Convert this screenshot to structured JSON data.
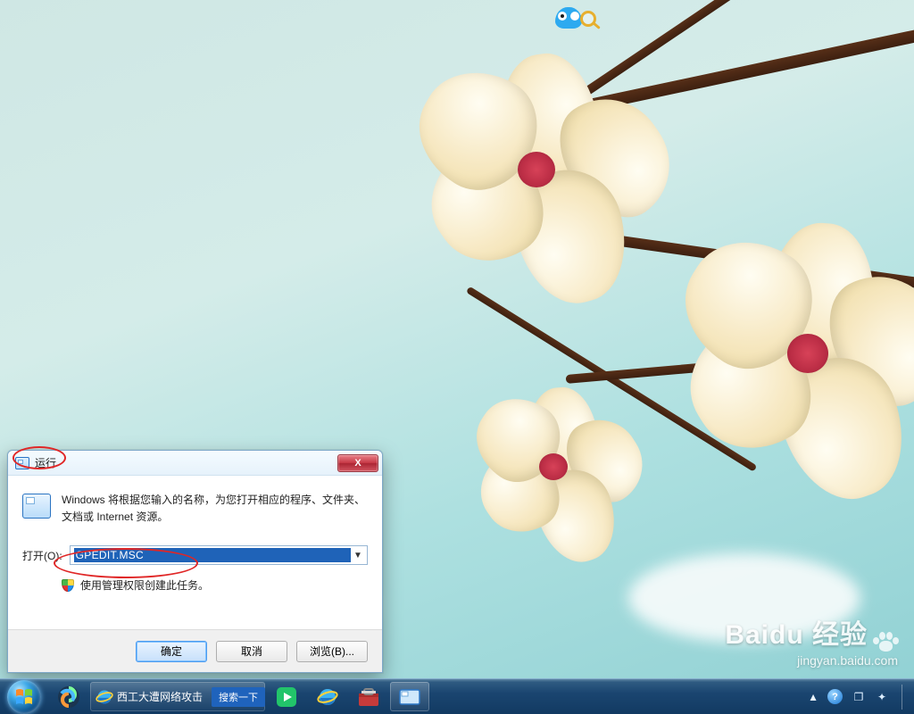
{
  "desktop": {
    "icon_name": "owl-search-app"
  },
  "run_dialog": {
    "title": "运行",
    "description": "Windows 将根据您输入的名称，为您打开相应的程序、文件夹、文档或 Internet 资源。",
    "open_label": "打开(O):",
    "input_value": "GPEDIT.MSC",
    "admin_checkbox_label": "使用管理权限创建此任务。",
    "close_glyph": "X",
    "dropdown_glyph": "▼",
    "buttons": {
      "ok": "确定",
      "cancel": "取消",
      "browse": "浏览(B)..."
    }
  },
  "taskbar": {
    "ie_task_title": "西工大遭网络攻击",
    "ie_search_btn": "搜索一下"
  },
  "watermark": {
    "brand": "Baidu 经验",
    "url": "jingyan.baidu.com"
  }
}
